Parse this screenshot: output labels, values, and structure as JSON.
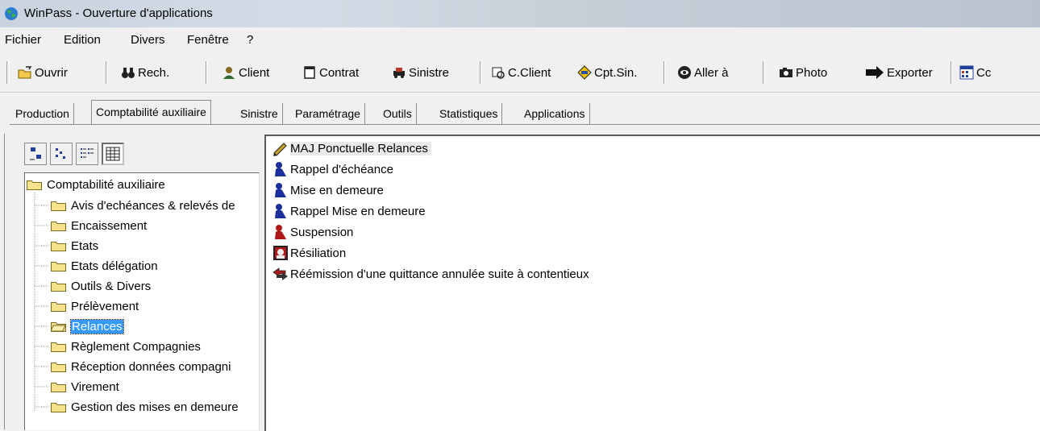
{
  "window": {
    "title": "WinPass - Ouverture d'applications"
  },
  "menu": [
    "Fichier",
    "Edition",
    "Divers",
    "Fenêtre",
    "?"
  ],
  "toolbar": {
    "buttons": [
      {
        "label": "Ouvrir",
        "icon": "open-folder-icon"
      },
      {
        "label": "Rech.",
        "icon": "binoculars-icon"
      },
      {
        "label": "Client",
        "icon": "client-icon"
      },
      {
        "label": "Contrat",
        "icon": "contract-icon"
      },
      {
        "label": "Sinistre",
        "icon": "car-crash-icon"
      },
      {
        "label": "C.Client",
        "icon": "client-account-icon"
      },
      {
        "label": "Cpt.Sin.",
        "icon": "claim-account-icon"
      },
      {
        "label": "Aller à",
        "icon": "goto-icon"
      },
      {
        "label": "Photo",
        "icon": "camera-icon"
      },
      {
        "label": "Exporter",
        "icon": "export-arrow-icon"
      },
      {
        "label": "Cc",
        "icon": "calendar-icon"
      }
    ]
  },
  "tabs": [
    {
      "label": "Production"
    },
    {
      "label": "Comptabilité auxiliaire",
      "selected": true
    },
    {
      "label": "Sinistre"
    },
    {
      "label": "Paramétrage"
    },
    {
      "label": "Outils"
    },
    {
      "label": "Statistiques"
    },
    {
      "label": "Applications"
    }
  ],
  "view_buttons": [
    "large-icons-view-icon",
    "small-icons-view-icon",
    "list-view-icon",
    "details-view-icon"
  ],
  "tree": {
    "root": "Comptabilité auxiliaire",
    "children": [
      "Avis d'echéances & relevés de",
      "Encaissement",
      "Etats",
      "Etats délégation",
      "Outils & Divers",
      "Prélèvement",
      "Relances",
      "Règlement Compagnies",
      "Réception données compagni",
      "Virement",
      "Gestion des mises en demeure"
    ],
    "selected": "Relances"
  },
  "list": {
    "items": [
      {
        "label": "MAJ Ponctuelle Relances",
        "icon": "update-pen-icon"
      },
      {
        "label": "Rappel d'échéance",
        "icon": "blue-person-icon"
      },
      {
        "label": "Mise en demeure",
        "icon": "blue-person-icon"
      },
      {
        "label": "Rappel Mise en demeure",
        "icon": "blue-person-icon"
      },
      {
        "label": "Suspension",
        "icon": "red-person-icon"
      },
      {
        "label": "Résiliation",
        "icon": "termination-icon"
      },
      {
        "label": "Réémission d'une quittance annulée suite à contentieux",
        "icon": "reissue-arrows-icon"
      }
    ]
  },
  "colors": {
    "selection": "#3399ff",
    "folder": "#f7e28c"
  }
}
